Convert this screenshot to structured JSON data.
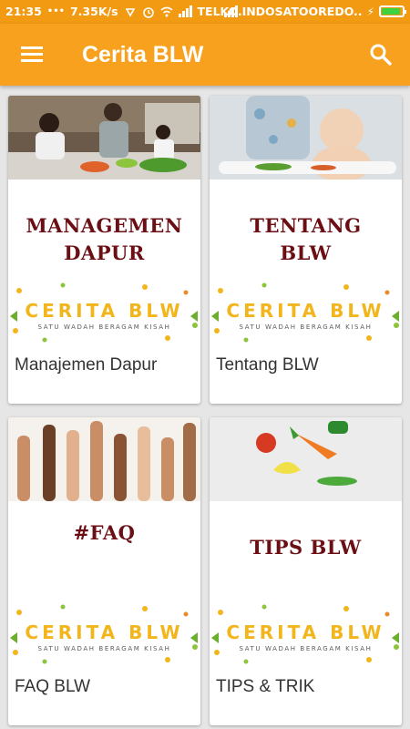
{
  "status_bar": {
    "time": "21:35",
    "speed": "7.35K/s",
    "carrier1": "TELKO..",
    "carrier2": "INDOSATOOREDO.."
  },
  "app_bar": {
    "title": "Cerita BLW",
    "menu_icon": "hamburger-menu-icon",
    "search_icon": "search-icon"
  },
  "logo": {
    "text": "CERITA BLW",
    "tagline": "SATU WADAH BERAGAM KISAH"
  },
  "cards": [
    {
      "headline_line1": "MANAGEMEN",
      "headline_line2": "DAPUR",
      "caption": "Manajemen Dapur",
      "image": "family-cooking-photo"
    },
    {
      "headline_line1": "TENTANG",
      "headline_line2": "BLW",
      "caption": "Tentang BLW",
      "image": "baby-eating-photo"
    },
    {
      "headline_line1": "#FAQ",
      "headline_line2": "",
      "caption": "FAQ BLW",
      "image": "raised-hands-photo"
    },
    {
      "headline_line1": "TIPS BLW",
      "headline_line2": "",
      "caption": "TIPS & TRIK",
      "image": "toy-vegetables-photo"
    }
  ],
  "colors": {
    "app_bar": "#f7a11f",
    "status_bar": "#f19a12",
    "headline": "#6b0f14",
    "logo_accent": "#f2b51c"
  }
}
